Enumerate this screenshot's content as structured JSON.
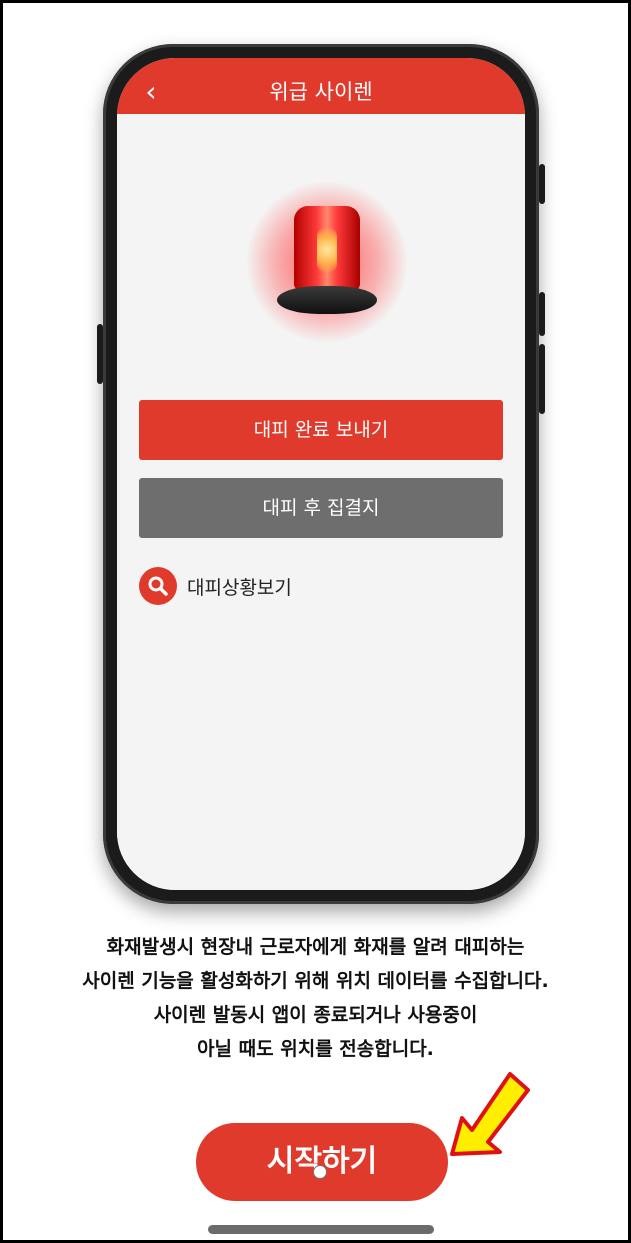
{
  "app": {
    "header_title": "위급 사이렌",
    "back_icon": "chevron-left-icon",
    "primary_button_label": "대피 완료 보내기",
    "secondary_button_label": "대피 후 집결지",
    "status_link_label": "대피상황보기",
    "siren_icon": "siren-icon",
    "accent_color": "#e03a2c",
    "secondary_color": "#6e6e6e"
  },
  "description": {
    "lines": [
      "화재발생시 현장내 근로자에게 화재를 알려 대피하는",
      "사이렌 기능을 활성화하기 위해 위치 데이터를 수집합니다.",
      "사이렌 발동시 앱이 종료되거나 사용중이",
      "아닐 때도 위치를 전송합니다."
    ]
  },
  "start_button": {
    "label": "시작하기"
  },
  "annotation": {
    "arrow_icon": "pointer-arrow-icon",
    "arrow_color": "#ffee00"
  }
}
